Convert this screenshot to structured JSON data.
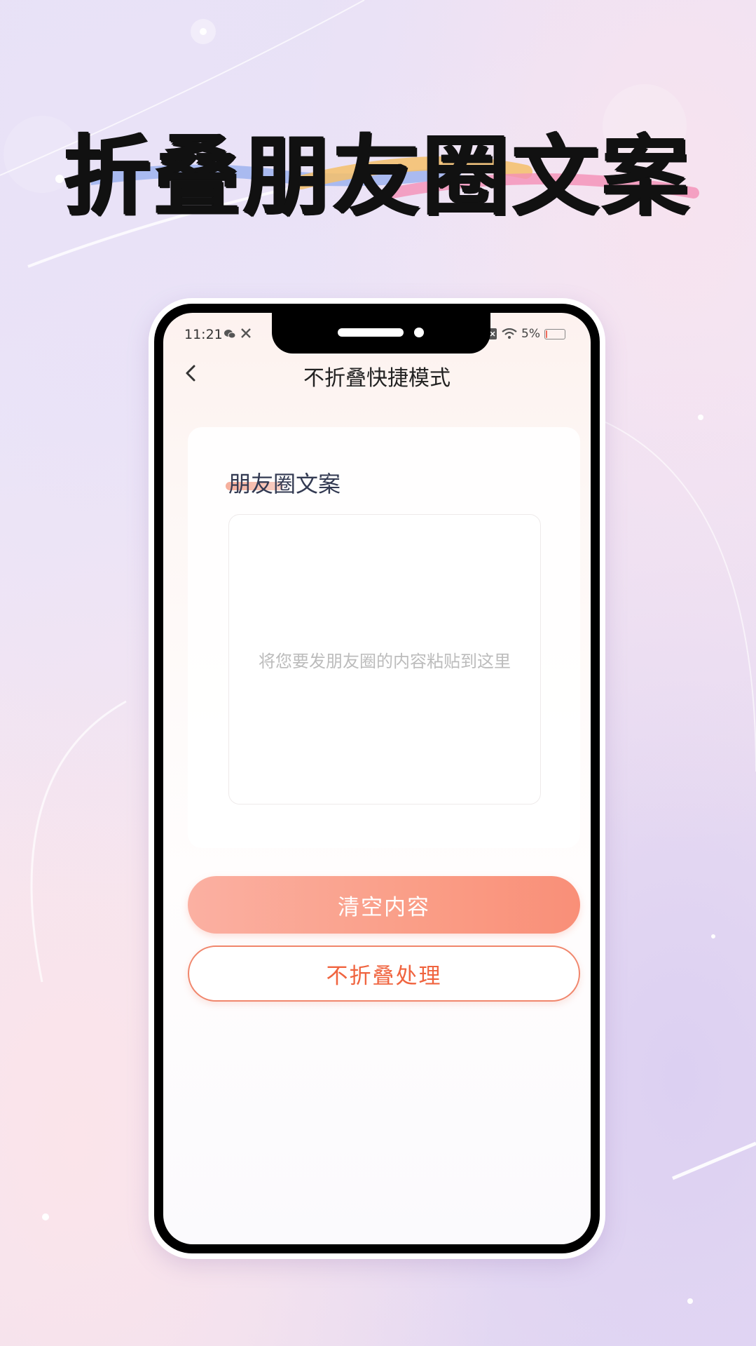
{
  "promo": {
    "headline": "折叠朋友圈文案"
  },
  "status_bar": {
    "time": "11:21",
    "left_icons": [
      "wechat-icon",
      "tools-icon"
    ],
    "right_icons": [
      "sim-icon",
      "wifi-icon"
    ],
    "battery_text": "5%",
    "battery_level": 0.05
  },
  "nav": {
    "back_icon": "chevron-left-icon",
    "title": "不折叠快捷模式"
  },
  "card": {
    "label": "朋友圈文案",
    "textarea": {
      "value": "",
      "placeholder": "将您要发朋友圈的内容粘贴到这里"
    }
  },
  "buttons": {
    "clear_label": "清空内容",
    "process_label": "不折叠处理"
  },
  "colors": {
    "accent": "#f98f78",
    "accent_text": "#f0643f",
    "headline": "#111111"
  }
}
